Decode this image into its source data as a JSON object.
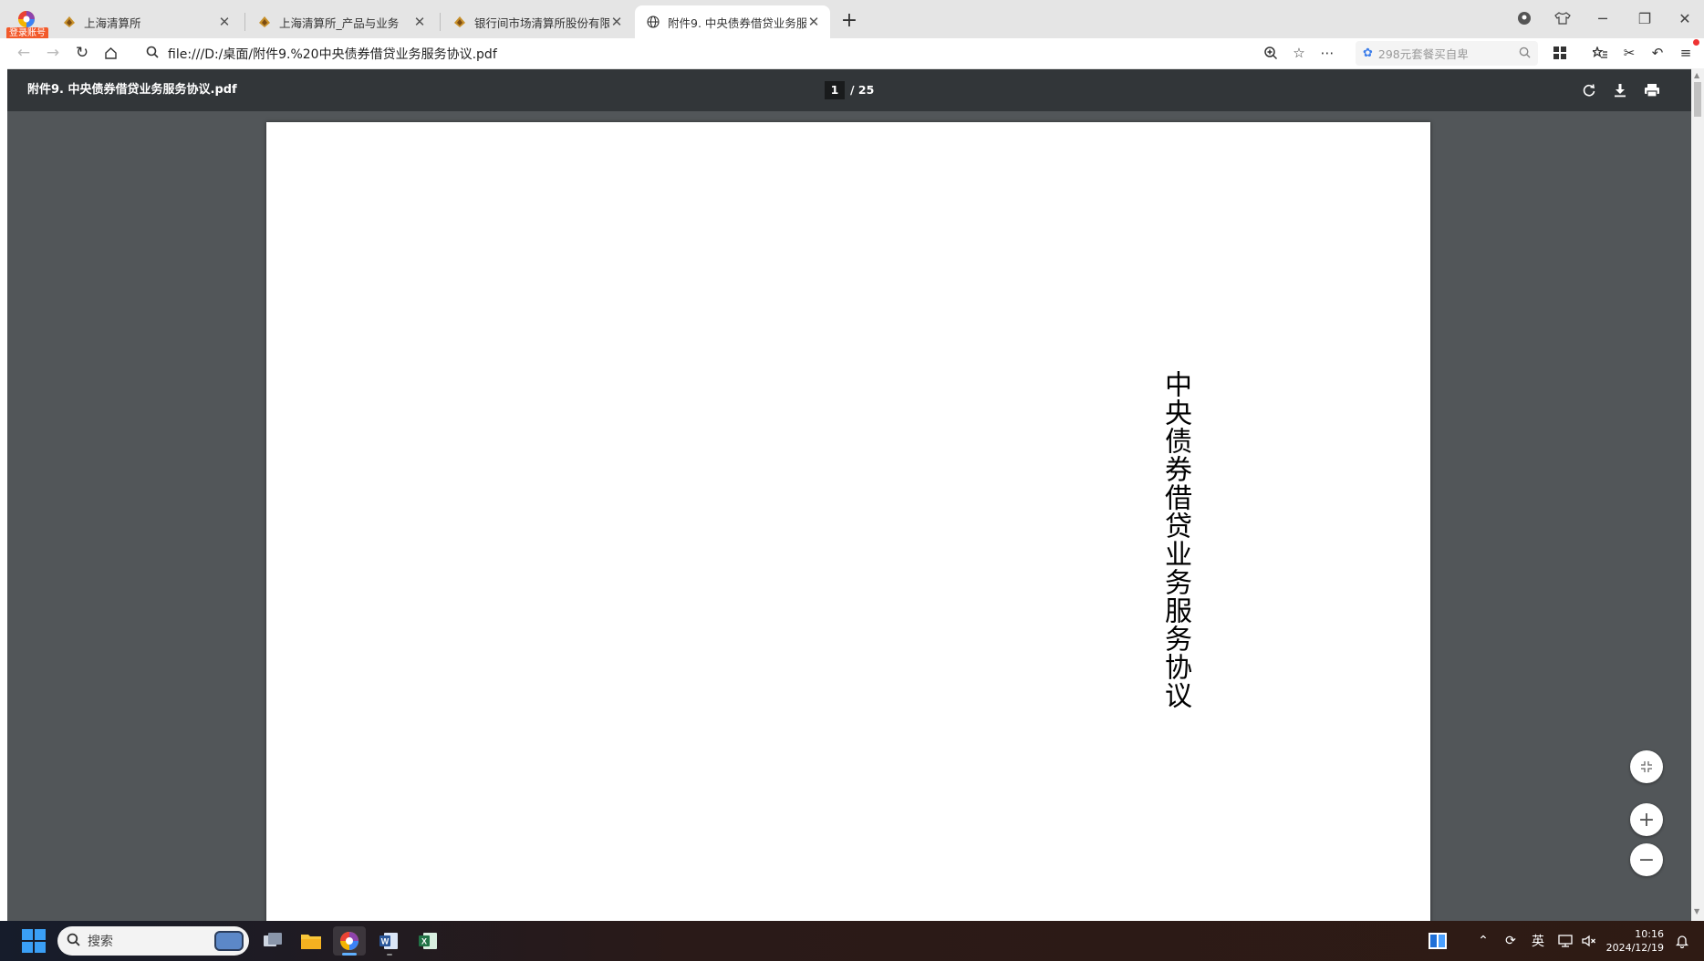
{
  "browser": {
    "login_badge": "登录账号",
    "tabs": [
      {
        "label": "上海清算所",
        "active": false
      },
      {
        "label": "上海清算所_产品与业务",
        "active": false
      },
      {
        "label": "银行间市场清算所股份有限公",
        "active": false
      },
      {
        "label": "附件9. 中央债券借贷业务服务",
        "active": true
      }
    ],
    "address": "file:///D:/桌面/附件9.%20中央债券借贷业务服务协议.pdf",
    "side_search_placeholder": "298元套餐买自卑"
  },
  "pdf": {
    "filename": "附件9. 中央债券借贷业务服务协议.pdf",
    "page_current": "1",
    "page_total": "/ 25",
    "document_title": "中央债券借贷业务服务协议"
  },
  "taskbar": {
    "search_placeholder": "搜索",
    "ime_label": "英",
    "time": "10:16",
    "date": "2024/12/19"
  },
  "colors": {
    "pdf_toolbar": "#323639",
    "pdf_background": "#525659",
    "tab_strip": "#e5e5e5",
    "accent_blue": "#3a9ff5"
  },
  "icons": [
    "browser-logo-icon",
    "site-favicon-icon",
    "globe-icon",
    "close-icon",
    "plus-icon",
    "back-icon",
    "forward-icon",
    "reload-icon",
    "home-icon",
    "search-icon",
    "zoom-icon",
    "star-icon",
    "more-icon",
    "grid-icon",
    "favorites-icon",
    "scissors-icon",
    "undo-icon",
    "menu-icon",
    "rotate-icon",
    "download-icon",
    "print-icon",
    "fit-page-icon",
    "zoom-in-icon",
    "zoom-out-icon",
    "windows-start-icon",
    "file-explorer-icon",
    "word-icon",
    "excel-icon",
    "notification-icon"
  ]
}
